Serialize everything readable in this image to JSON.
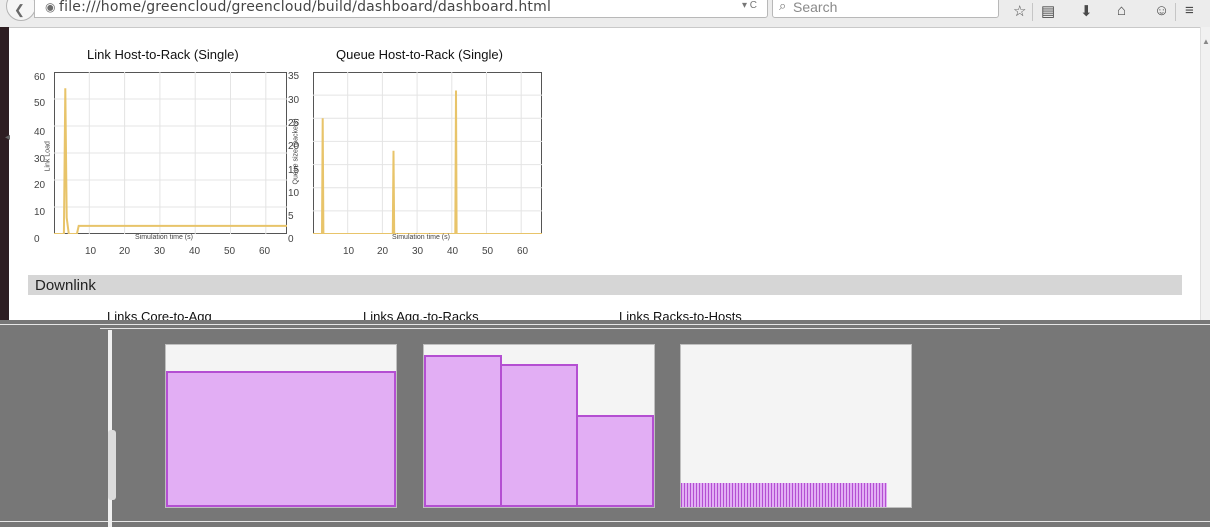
{
  "browser": {
    "url": "file:///home/greencloud/greencloud/build/dashboard/dashboard.html",
    "search_placeholder": "Search",
    "icons": [
      "back-arrow-icon",
      "globe-icon",
      "dropdown-icon",
      "reload-icon",
      "search-icon",
      "bookmark-star-icon",
      "reading-list-icon",
      "download-icon",
      "home-icon",
      "chat-icon",
      "menu-icon"
    ]
  },
  "charts": [
    {
      "title": "Link Host-to-Rack (Single)",
      "ylabel": "Link Load",
      "xlabel": "Simulation time (s)",
      "y_ticks": [
        "60",
        "50",
        "40",
        "30",
        "20",
        "10",
        "0"
      ],
      "x_ticks": [
        "10",
        "20",
        "30",
        "40",
        "50",
        "60"
      ]
    },
    {
      "title": "Queue Host-to-Rack (Single)",
      "ylabel": "Queue size (packets)",
      "xlabel": "Simulation time (s)",
      "y_ticks": [
        "35",
        "30",
        "25",
        "20",
        "15",
        "10",
        "5",
        "0"
      ],
      "x_ticks": [
        "10",
        "20",
        "30",
        "40",
        "50",
        "60"
      ]
    }
  ],
  "section": {
    "title": "Downlink",
    "subcharts": [
      "Links Core-to-Agg",
      "Links Agg.-to-Racks",
      "Links Racks-to-Hosts"
    ]
  },
  "chart_data": [
    {
      "type": "line",
      "title": "Link Host-to-Rack (Single)",
      "xlabel": "Simulation time (s)",
      "ylabel": "Link Load",
      "xlim": [
        0,
        66
      ],
      "ylim": [
        0,
        60
      ],
      "color": "#e8c46a",
      "x": [
        0,
        2.8,
        3.2,
        3.6,
        4.2,
        5.0,
        6.5,
        7.0,
        7.5,
        10,
        20,
        30,
        40,
        50,
        60,
        66
      ],
      "y": [
        0,
        0,
        54,
        6,
        0,
        0,
        0,
        3,
        3,
        3,
        3,
        3,
        3,
        3,
        3,
        3
      ]
    },
    {
      "type": "line",
      "title": "Queue Host-to-Rack (Single)",
      "xlabel": "Simulation time (s)",
      "ylabel": "Queue size (packets)",
      "xlim": [
        0,
        66
      ],
      "ylim": [
        0,
        35
      ],
      "color": "#e8c46a",
      "x": [
        0,
        2.6,
        2.8,
        3.0,
        20,
        23.0,
        23.2,
        23.4,
        40,
        41.0,
        41.2,
        41.4,
        66
      ],
      "y": [
        0,
        0,
        25,
        0,
        0,
        0,
        18,
        0,
        0,
        0,
        31,
        0,
        0
      ]
    }
  ],
  "glitch_colors": {
    "fill": "#e2aef4",
    "stroke": "#b44fd2",
    "bg": "#777777"
  }
}
